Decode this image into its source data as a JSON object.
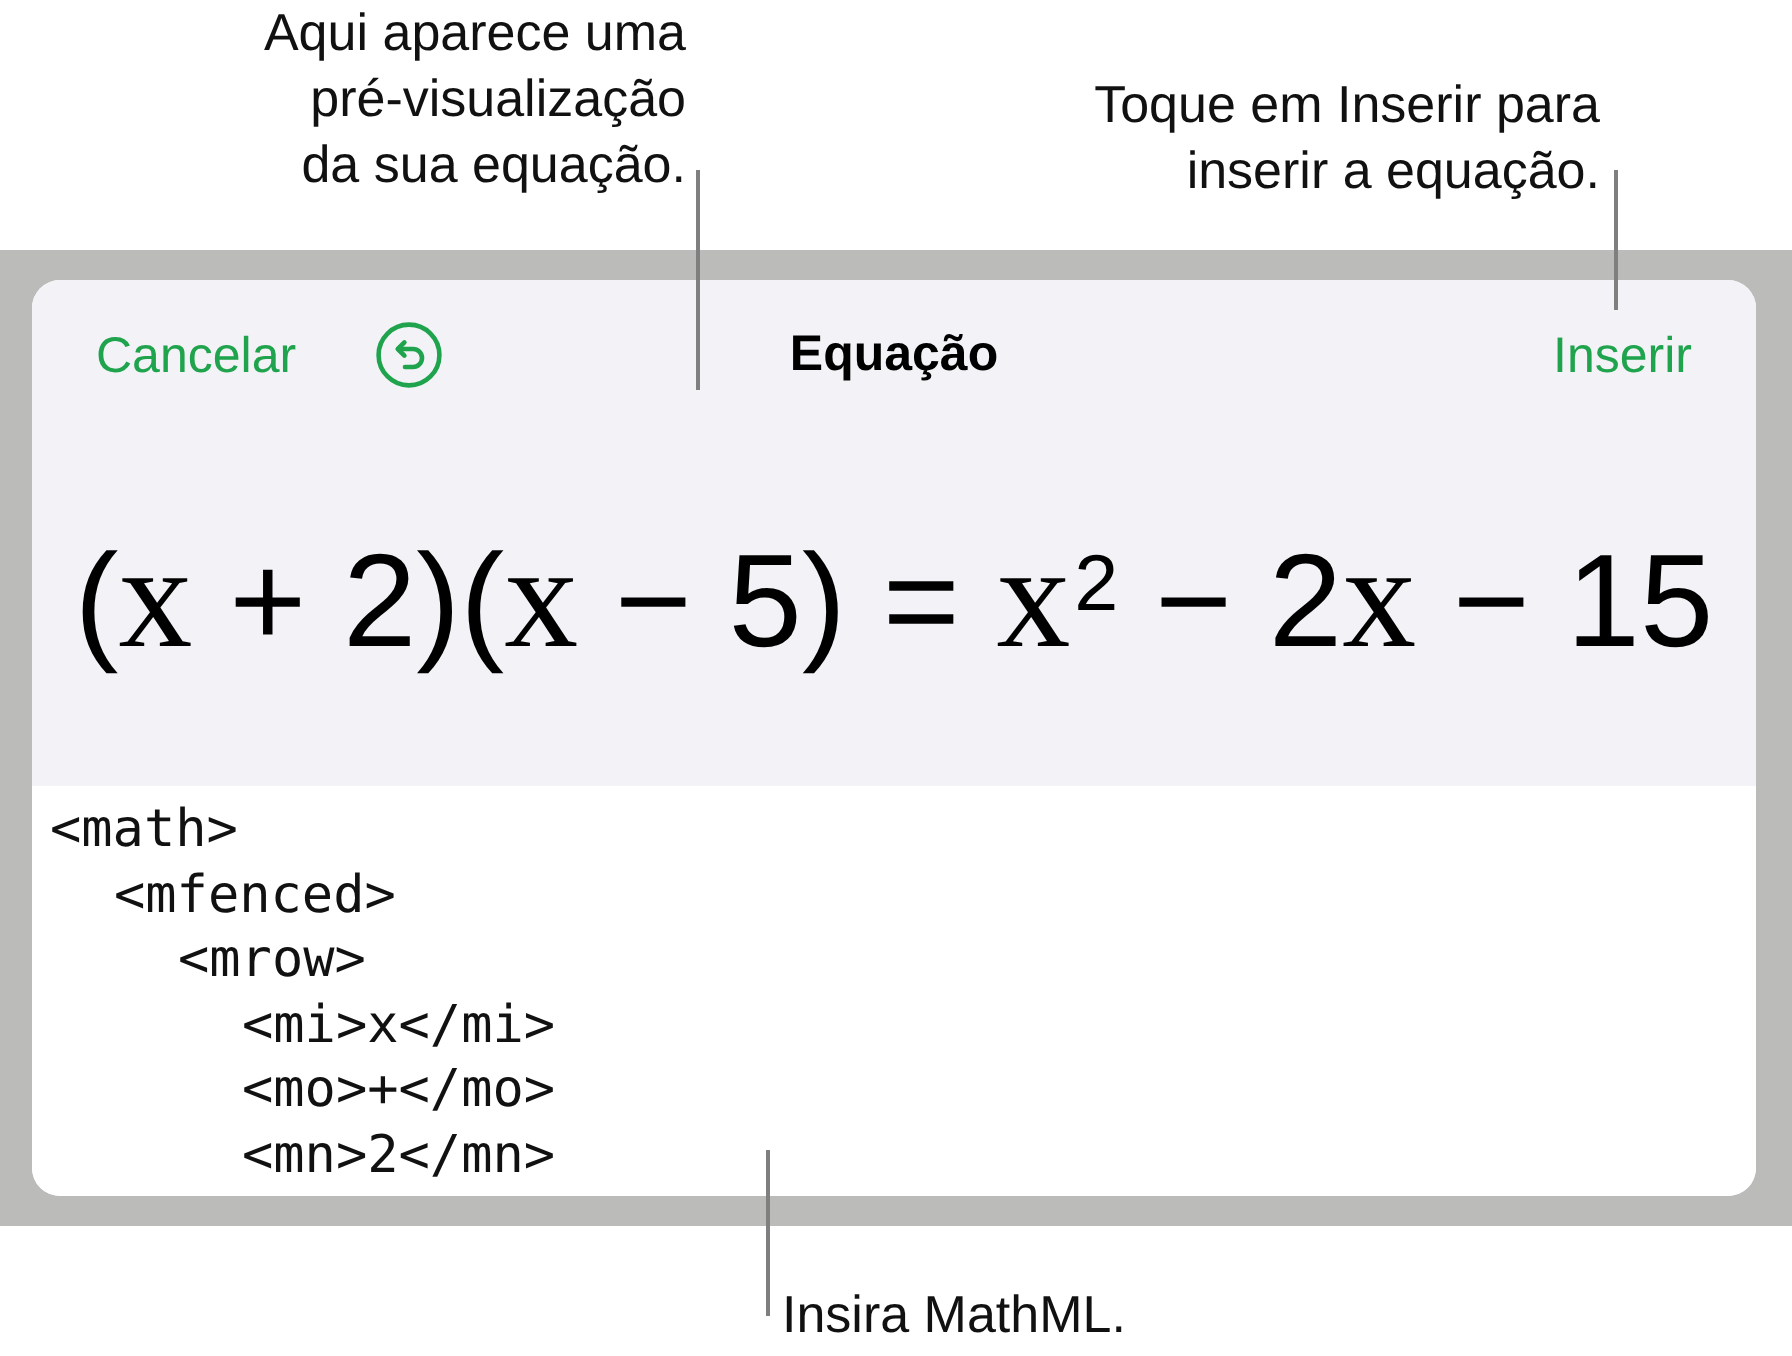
{
  "callouts": [
    {
      "lines": [
        "Aqui aparece uma",
        "pré-visualização",
        "da sua equação."
      ]
    },
    {
      "lines": [
        "Toque em Inserir para",
        "inserir a equação."
      ]
    }
  ],
  "dialog": {
    "cancel_button": "Cancelar",
    "title": "Equação",
    "insert_button": "Inserir"
  },
  "equation": {
    "segments": [
      {
        "kind": "text",
        "text": "("
      },
      {
        "kind": "var",
        "text": "x"
      },
      {
        "kind": "text",
        "text": " + 2)("
      },
      {
        "kind": "var",
        "text": "x"
      },
      {
        "kind": "text",
        "text": " − 5) = "
      },
      {
        "kind": "var",
        "text": "x"
      },
      {
        "kind": "sup",
        "text": "2"
      },
      {
        "kind": "text",
        "text": " − 2"
      },
      {
        "kind": "var",
        "text": "x"
      },
      {
        "kind": "text",
        "text": " − 15"
      }
    ]
  },
  "mathml": [
    {
      "text": "<math>",
      "children": [
        {
          "text": "<mfenced>",
          "children": [
            {
              "text": "<mrow>",
              "children": [
                {
                  "text": "<mi>x</mi>"
                },
                {
                  "text": "<mo>+</mo>"
                },
                {
                  "text": "<mn>2</mn>"
                }
              ]
            }
          ]
        }
      ]
    }
  ],
  "bottom_callout": {
    "lines": [
      "Insira MathML."
    ]
  }
}
